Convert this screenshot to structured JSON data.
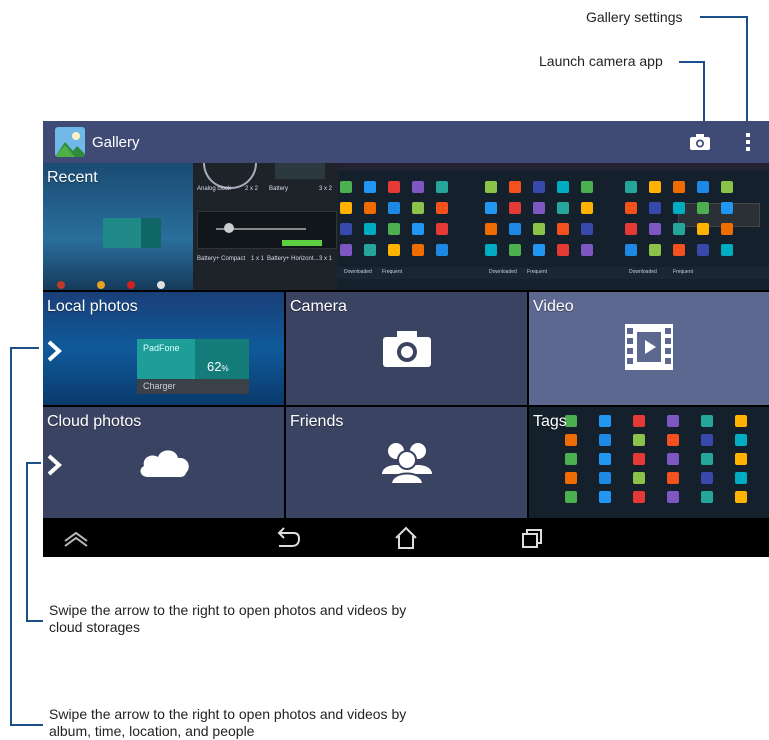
{
  "callouts": {
    "gallery_settings": "Gallery settings",
    "launch_camera": "Launch camera app",
    "cloud_arrow": "Swipe the arrow to the right to open photos and videos by cloud storages",
    "local_arrow": "Swipe the arrow to the right to open photos and videos by album, time, location, and people"
  },
  "app": {
    "title": "Gallery"
  },
  "tiles": {
    "recent": "Recent",
    "local_photos": "Local photos",
    "camera": "Camera",
    "video": "Video",
    "cloud_photos": "Cloud photos",
    "friends": "Friends",
    "tags": "Tags"
  },
  "widgets": {
    "analog_clock": "Analog clock",
    "analog_clock_size": "2 x 2",
    "battery": "Battery",
    "battery_size": "3 x 2",
    "battery_compact": "Battery+ Compact",
    "battery_compact_size": "1 x 1",
    "battery_horizontal": "Battery+ Horizont...",
    "battery_horizontal_size": "3 x 1",
    "padfone": "PadFone",
    "percent": "62",
    "percent_unit": "%",
    "charger": "Charger",
    "downloaded": "Downloaded",
    "frequent": "Frequent"
  },
  "icons": {
    "camera": "camera-icon",
    "overflow": "overflow-menu-icon",
    "video": "video-icon",
    "cloud": "cloud-icon",
    "friends": "friends-icon",
    "arrow": "chevron-right-icon",
    "nav_up": "collapse-icon",
    "nav_back": "back-icon",
    "nav_home": "home-icon",
    "nav_recent": "recent-apps-icon"
  },
  "colors": {
    "action_bar": "#3f4b75",
    "tile": "#3a4362",
    "video_tile": "#5d6890",
    "callout_line": "#1b4f8a"
  }
}
